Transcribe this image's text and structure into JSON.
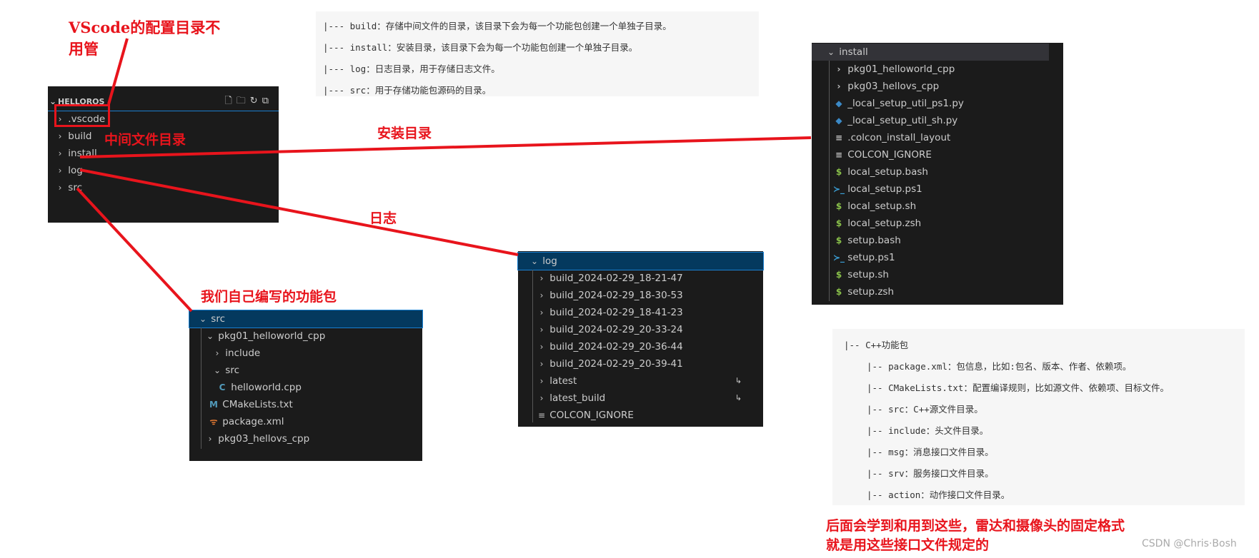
{
  "annotations": {
    "vscode_note": "VScode的配置目录不用管",
    "build_note": "中间文件目录",
    "install_note": "安装目录",
    "log_note": "日志",
    "src_note": "我们自己编写的功能包",
    "bottom_note_1": "后面会学到和用到这些，雷达和摄像头的固定格式",
    "bottom_note_2": "就是用这些接口文件规定的",
    "color": "#e8141c"
  },
  "top_block": [
    "|--- build：存储中间文件的目录，该目录下会为每一个功能包创建一个单独子目录。",
    "|--- install：安装目录，该目录下会为每一个功能包创建一个单独子目录。",
    "|--- log：日志目录，用于存储日志文件。",
    "|--- src：用于存储功能包源码的目录。"
  ],
  "workspace": {
    "title": "HELLOROS",
    "items": [
      ".vscode",
      "build",
      "install",
      "log",
      "src"
    ]
  },
  "src_tree": {
    "root": "src",
    "items": [
      {
        "label": "pkg01_helloworld_cpp",
        "icon": "chevron-down"
      },
      {
        "label": "include",
        "icon": "chevron-right"
      },
      {
        "label": "src",
        "icon": "chevron-down"
      },
      {
        "label": "helloworld.cpp",
        "icon": "cpp"
      },
      {
        "label": "CMakeLists.txt",
        "icon": "cmake"
      },
      {
        "label": "package.xml",
        "icon": "xml"
      },
      {
        "label": "pkg03_hellovs_cpp",
        "icon": "chevron-right"
      }
    ]
  },
  "log_tree": {
    "root": "log",
    "items": [
      "build_2024-02-29_18-21-47",
      "build_2024-02-29_18-30-53",
      "build_2024-02-29_18-41-23",
      "build_2024-02-29_20-33-24",
      "build_2024-02-29_20-36-44",
      "build_2024-02-29_20-39-41",
      "latest",
      "latest_build",
      "COLCON_IGNORE"
    ]
  },
  "install_tree": {
    "root": "install",
    "items": [
      {
        "label": "pkg01_helloworld_cpp",
        "icon": "chevron"
      },
      {
        "label": "pkg03_hellovs_cpp",
        "icon": "chevron"
      },
      {
        "label": "_local_setup_util_ps1.py",
        "icon": "python"
      },
      {
        "label": "_local_setup_util_sh.py",
        "icon": "python"
      },
      {
        "label": ".colcon_install_layout",
        "icon": "text"
      },
      {
        "label": "COLCON_IGNORE",
        "icon": "text"
      },
      {
        "label": "local_setup.bash",
        "icon": "shell"
      },
      {
        "label": "local_setup.ps1",
        "icon": "powershell"
      },
      {
        "label": "local_setup.sh",
        "icon": "shell"
      },
      {
        "label": "local_setup.zsh",
        "icon": "shell"
      },
      {
        "label": "setup.bash",
        "icon": "shell"
      },
      {
        "label": "setup.ps1",
        "icon": "powershell"
      },
      {
        "label": "setup.sh",
        "icon": "shell"
      },
      {
        "label": "setup.zsh",
        "icon": "shell"
      }
    ]
  },
  "bottom_block": [
    "|-- C++功能包",
    "|-- package.xml：包信息，比如:包名、版本、作者、依赖项。",
    "|-- CMakeLists.txt：配置编译规则，比如源文件、依赖项、目标文件。",
    "|-- src：C++源文件目录。",
    "|-- include：头文件目录。",
    "|-- msg：消息接口文件目录。",
    "|-- srv：服务接口文件目录。",
    "|-- action：动作接口文件目录。"
  ],
  "watermark": "CSDN @Chris·Bosh"
}
